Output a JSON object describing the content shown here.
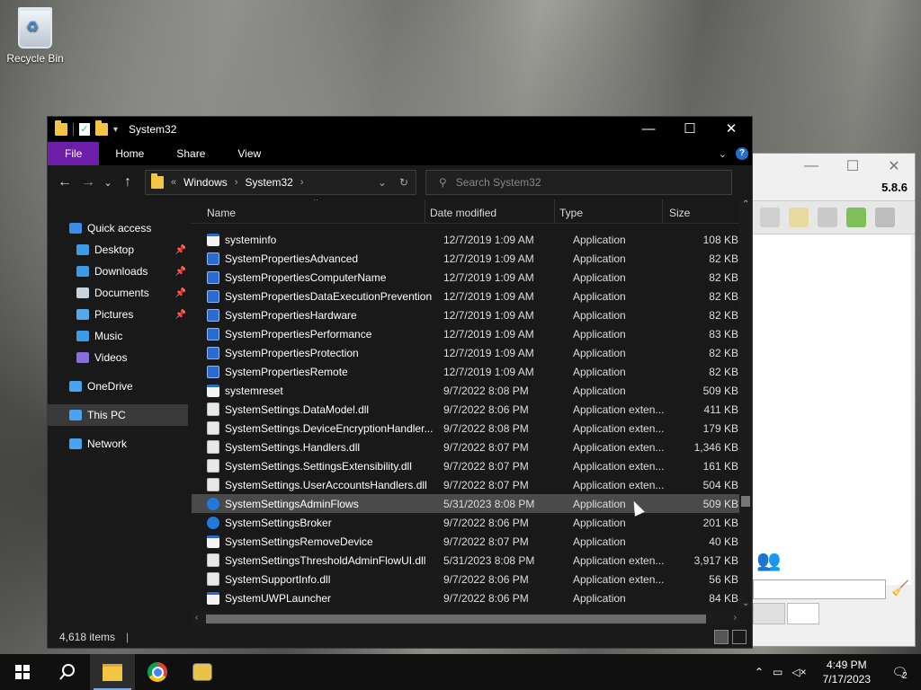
{
  "desktop": {
    "recycle_bin_label": "Recycle Bin"
  },
  "bg_window": {
    "version": "5.8.6"
  },
  "explorer": {
    "title": "System32",
    "ribbon_tabs": [
      "File",
      "Home",
      "Share",
      "View"
    ],
    "breadcrumb": {
      "root": "«",
      "crumbs": [
        "Windows",
        "System32"
      ]
    },
    "search_placeholder": "Search System32",
    "nav": [
      {
        "label": "Quick access",
        "icon": "star-icon",
        "color": "#3b8ee8"
      },
      {
        "label": "Desktop",
        "icon": "desktop-folder-icon",
        "color": "#3c9be6",
        "pinned": true
      },
      {
        "label": "Downloads",
        "icon": "download-folder-icon",
        "color": "#3c9be6",
        "pinned": true
      },
      {
        "label": "Documents",
        "icon": "documents-folder-icon",
        "color": "#c9d3de",
        "pinned": true
      },
      {
        "label": "Pictures",
        "icon": "pictures-folder-icon",
        "color": "#5aa7e6",
        "pinned": true
      },
      {
        "label": "Music",
        "icon": "music-folder-icon",
        "color": "#3c9be6"
      },
      {
        "label": "Videos",
        "icon": "videos-folder-icon",
        "color": "#8a6de0"
      },
      {
        "label": "OneDrive",
        "icon": "onedrive-icon",
        "color": "#4aa3f0"
      },
      {
        "label": "This PC",
        "icon": "this-pc-icon",
        "color": "#4aa3f0",
        "selected": true
      },
      {
        "label": "Network",
        "icon": "network-icon",
        "color": "#4aa3f0"
      }
    ],
    "columns": {
      "name": "Name",
      "date": "Date modified",
      "type": "Type",
      "size": "Size"
    },
    "files": [
      {
        "name": "systeminfo",
        "date": "12/7/2019 1:09 AM",
        "type": "Application",
        "size": "108 KB",
        "icon": "app"
      },
      {
        "name": "SystemPropertiesAdvanced",
        "date": "12/7/2019 1:09 AM",
        "type": "Application",
        "size": "82 KB",
        "icon": "spa"
      },
      {
        "name": "SystemPropertiesComputerName",
        "date": "12/7/2019 1:09 AM",
        "type": "Application",
        "size": "82 KB",
        "icon": "spa"
      },
      {
        "name": "SystemPropertiesDataExecutionPrevention",
        "date": "12/7/2019 1:09 AM",
        "type": "Application",
        "size": "82 KB",
        "icon": "spa"
      },
      {
        "name": "SystemPropertiesHardware",
        "date": "12/7/2019 1:09 AM",
        "type": "Application",
        "size": "82 KB",
        "icon": "spa"
      },
      {
        "name": "SystemPropertiesPerformance",
        "date": "12/7/2019 1:09 AM",
        "type": "Application",
        "size": "83 KB",
        "icon": "spa"
      },
      {
        "name": "SystemPropertiesProtection",
        "date": "12/7/2019 1:09 AM",
        "type": "Application",
        "size": "82 KB",
        "icon": "spa"
      },
      {
        "name": "SystemPropertiesRemote",
        "date": "12/7/2019 1:09 AM",
        "type": "Application",
        "size": "82 KB",
        "icon": "spa"
      },
      {
        "name": "systemreset",
        "date": "9/7/2022 8:08 PM",
        "type": "Application",
        "size": "509 KB",
        "icon": "app"
      },
      {
        "name": "SystemSettings.DataModel.dll",
        "date": "9/7/2022 8:06 PM",
        "type": "Application exten...",
        "size": "411 KB",
        "icon": "dll"
      },
      {
        "name": "SystemSettings.DeviceEncryptionHandler...",
        "date": "9/7/2022 8:08 PM",
        "type": "Application exten...",
        "size": "179 KB",
        "icon": "dll"
      },
      {
        "name": "SystemSettings.Handlers.dll",
        "date": "9/7/2022 8:07 PM",
        "type": "Application exten...",
        "size": "1,346 KB",
        "icon": "dll"
      },
      {
        "name": "SystemSettings.SettingsExtensibility.dll",
        "date": "9/7/2022 8:07 PM",
        "type": "Application exten...",
        "size": "161 KB",
        "icon": "dll"
      },
      {
        "name": "SystemSettings.UserAccountsHandlers.dll",
        "date": "9/7/2022 8:07 PM",
        "type": "Application exten...",
        "size": "504 KB",
        "icon": "dll"
      },
      {
        "name": "SystemSettingsAdminFlows",
        "date": "5/31/2023 8:08 PM",
        "type": "Application",
        "size": "509 KB",
        "icon": "gear",
        "selected": true
      },
      {
        "name": "SystemSettingsBroker",
        "date": "9/7/2022 8:06 PM",
        "type": "Application",
        "size": "201 KB",
        "icon": "gear"
      },
      {
        "name": "SystemSettingsRemoveDevice",
        "date": "9/7/2022 8:07 PM",
        "type": "Application",
        "size": "40 KB",
        "icon": "app"
      },
      {
        "name": "SystemSettingsThresholdAdminFlowUI.dll",
        "date": "5/31/2023 8:08 PM",
        "type": "Application exten...",
        "size": "3,917 KB",
        "icon": "dll"
      },
      {
        "name": "SystemSupportInfo.dll",
        "date": "9/7/2022 8:06 PM",
        "type": "Application exten...",
        "size": "56 KB",
        "icon": "dll"
      },
      {
        "name": "SystemUWPLauncher",
        "date": "9/7/2022 8:06 PM",
        "type": "Application",
        "size": "84 KB",
        "icon": "app"
      }
    ],
    "status": "4,618 items"
  },
  "taskbar": {
    "time": "4:49 PM",
    "date": "7/17/2023",
    "notification_count": "2"
  }
}
